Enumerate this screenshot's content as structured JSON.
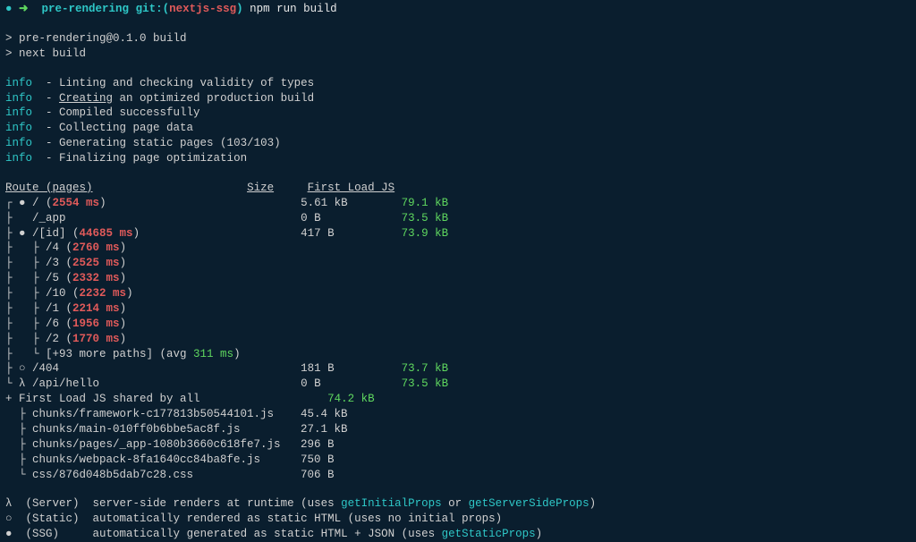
{
  "prompt": {
    "dot": "●",
    "arrow": "➜",
    "dir": "pre-rendering",
    "git_label": "git:(",
    "branch": "nextjs-ssg",
    "git_close": ")",
    "cmd": "npm run build"
  },
  "npm": {
    "l1": "> pre-rendering@0.1.0 build",
    "l2": "> next build"
  },
  "info": [
    {
      "msg": "Linting and checking validity of types",
      "underline_word": ""
    },
    {
      "msg_pre": "",
      "underline_word": "Creating",
      "msg_post": " an optimized production build"
    },
    {
      "msg": "Compiled successfully"
    },
    {
      "msg": "Collecting page data"
    },
    {
      "msg": "Generating static pages (103/103)"
    },
    {
      "msg": "Finalizing page optimization"
    }
  ],
  "info_label": "info",
  "info_dash": "  - ",
  "table": {
    "header": {
      "route": "Route (pages)",
      "size": "Size",
      "first": "First Load JS"
    },
    "rows": [
      {
        "tree": "┌ ● ",
        "path": "/",
        "timing": " (2554 ms)",
        "size": "5.61 kB",
        "first": "79.1 kB"
      },
      {
        "tree": "├   ",
        "path": "/_app",
        "timing": "",
        "size": "0 B",
        "first": "73.5 kB"
      },
      {
        "tree": "├ ● ",
        "path": "/[id]",
        "timing": " (44685 ms)",
        "size": "417 B",
        "first": "73.9 kB"
      }
    ],
    "children": [
      {
        "tree": "├   ├ ",
        "path": "/4",
        "timing": " (2760 ms)"
      },
      {
        "tree": "├   ├ ",
        "path": "/3",
        "timing": " (2525 ms)"
      },
      {
        "tree": "├   ├ ",
        "path": "/5",
        "timing": " (2332 ms)"
      },
      {
        "tree": "├   ├ ",
        "path": "/10",
        "timing": " (2232 ms)"
      },
      {
        "tree": "├   ├ ",
        "path": "/1",
        "timing": " (2214 ms)"
      },
      {
        "tree": "├   ├ ",
        "path": "/6",
        "timing": " (1956 ms)"
      },
      {
        "tree": "├   ├ ",
        "path": "/2",
        "timing": " (1770 ms)"
      }
    ],
    "more": {
      "tree": "├   └ ",
      "text_pre": "[+93 more paths] (avg ",
      "avg": "311 ms",
      "text_post": ")"
    },
    "rest": [
      {
        "tree": "├ ○ ",
        "path": "/404",
        "timing": "",
        "size": "181 B",
        "first": "73.7 kB"
      },
      {
        "tree": "└ λ ",
        "path": "/api/hello",
        "timing": "",
        "size": "0 B",
        "first": "73.5 kB"
      }
    ],
    "shared": {
      "label": "+ First Load JS shared by all",
      "total": "74.2 kB",
      "files": [
        {
          "tree": "  ├ ",
          "name": "chunks/framework-c177813b50544101.js",
          "size": "45.4 kB"
        },
        {
          "tree": "  ├ ",
          "name": "chunks/main-010ff0b6bbe5ac8f.js",
          "size": "27.1 kB"
        },
        {
          "tree": "  ├ ",
          "name": "chunks/pages/_app-1080b3660c618fe7.js",
          "size": "296 B"
        },
        {
          "tree": "  ├ ",
          "name": "chunks/webpack-8fa1640cc84ba8fe.js",
          "size": "750 B"
        },
        {
          "tree": "  └ ",
          "name": "css/876d048b5dab7c28.css",
          "size": "706 B"
        }
      ]
    }
  },
  "legend": [
    {
      "sym": "λ",
      "name": "(Server)",
      "desc_pre": "server-side renders at runtime (uses ",
      "cyan1": "getInitialProps",
      "mid": " or ",
      "cyan2": "getServerSideProps",
      "desc_post": ")"
    },
    {
      "sym": "○",
      "name": "(Static)",
      "desc_pre": "automatically rendered as static HTML (uses no initial props)",
      "cyan1": "",
      "mid": "",
      "cyan2": "",
      "desc_post": ""
    },
    {
      "sym": "●",
      "name": "(SSG)",
      "desc_pre": "automatically generated as static HTML + JSON (uses ",
      "cyan1": "getStaticProps",
      "mid": "",
      "cyan2": "",
      "desc_post": ")"
    }
  ]
}
